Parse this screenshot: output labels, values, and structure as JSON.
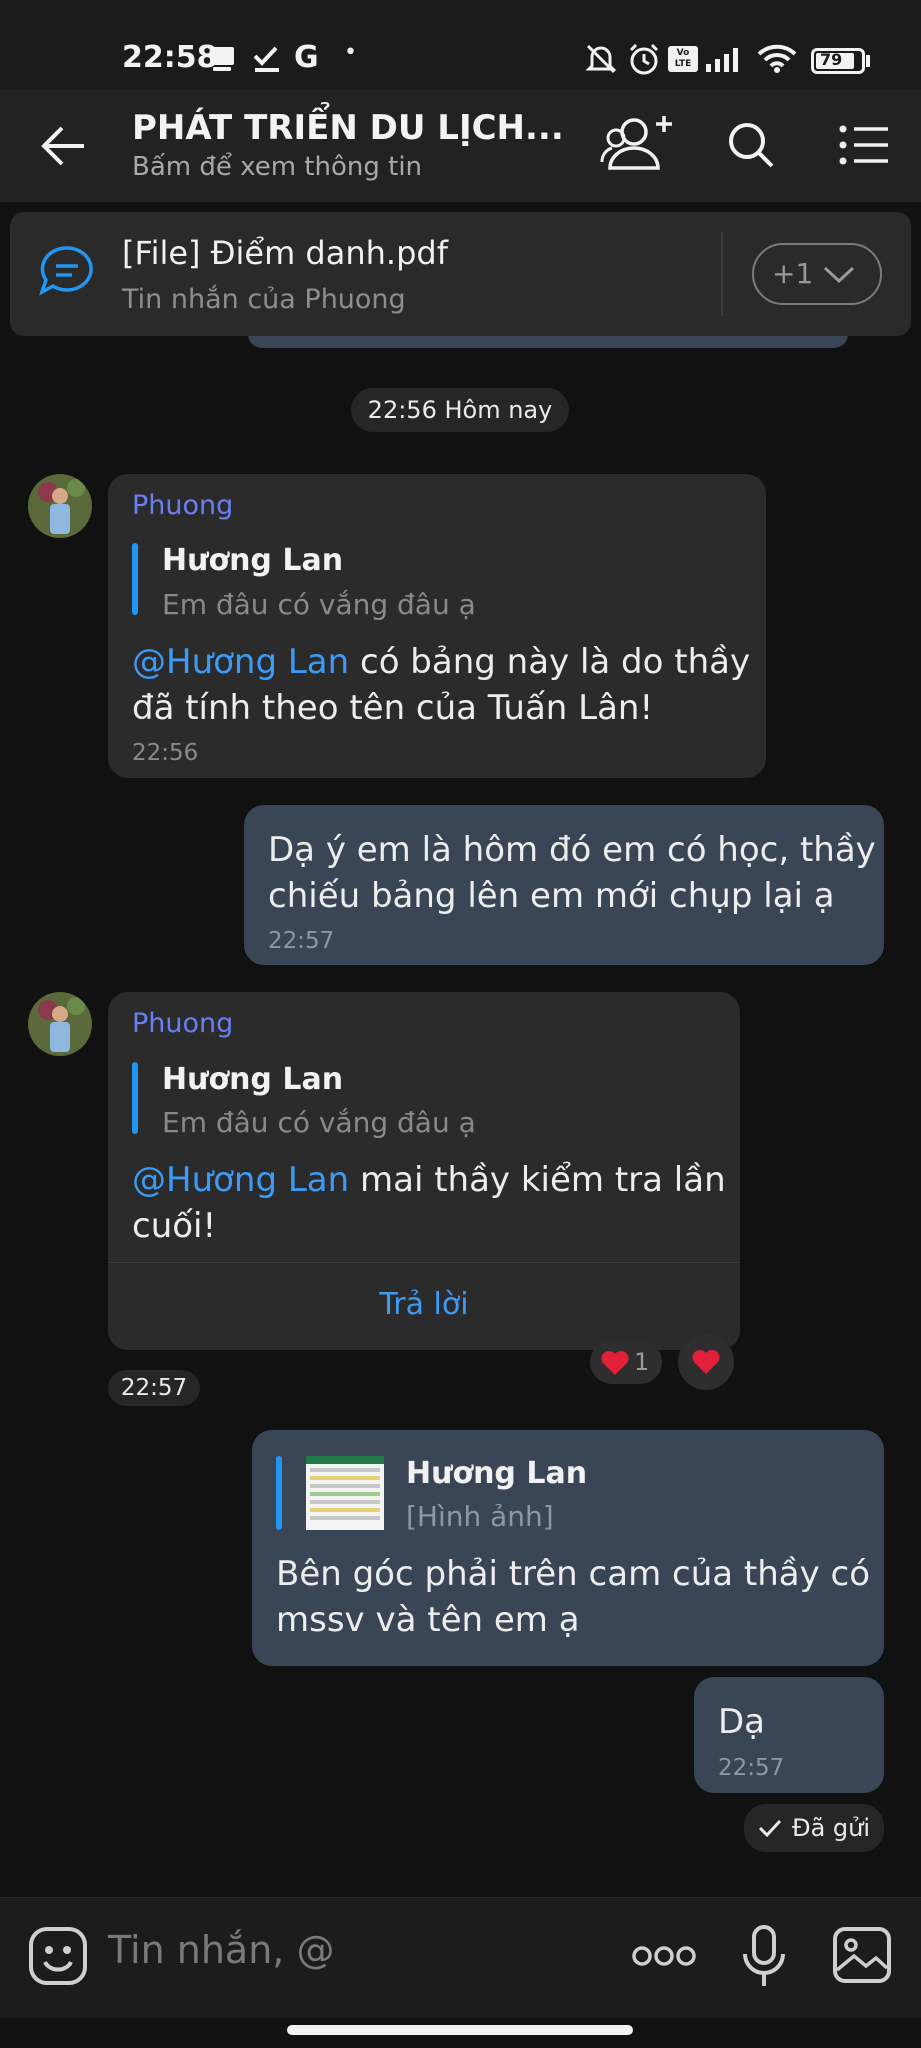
{
  "status_bar": {
    "time": "22:58",
    "g_label": "G",
    "dot": "•",
    "battery": "79",
    "volte_label": "Vo LTE"
  },
  "header": {
    "title": "PHÁT TRIỂN DU LỊCH...",
    "subtitle": "Bấm để xem thông tin"
  },
  "pinned": {
    "title": "[File] Điểm danh.pdf",
    "subtitle": "Tin nhắn của Phuong",
    "more_label": "+1"
  },
  "chat": {
    "date_chip": "22:56 Hôm nay",
    "messages": [
      {
        "sender": "Phuong",
        "quote_name": "Hương Lan",
        "quote_text": "Em đâu có vắng đâu ạ",
        "mention": "@Hương Lan",
        "line1": " có bảng này là do thầy",
        "line2": "đã tính theo tên của Tuấn Lân!",
        "time": "22:56"
      },
      {
        "line1": "Dạ ý em là hôm đó em có học, thầy",
        "line2": "chiếu bảng lên em mới chụp lại ạ",
        "time": "22:57"
      },
      {
        "sender": "Phuong",
        "quote_name": "Hương Lan",
        "quote_text": "Em đâu có vắng đâu ạ",
        "mention": "@Hương Lan",
        "line1": " mai thầy kiểm tra lần",
        "line2": "cuối!",
        "reply_label": "Trả lời",
        "time": "22:57",
        "reaction_count": "1"
      },
      {
        "quote_name": "Hương Lan",
        "quote_text": "[Hình ảnh]",
        "line1": "Bên góc phải trên cam của thầy có",
        "line2": "mssv và tên em ạ"
      },
      {
        "line1": "Dạ",
        "time": "22:57"
      }
    ],
    "sent_status": "Đã gửi"
  },
  "composer": {
    "placeholder": "Tin nhắn, @"
  },
  "colors": {
    "background": "#111111",
    "incoming_bubble": "#2b2b2b",
    "outgoing_bubble": "#3a4656",
    "accent": "#2196f3",
    "mention": "#3d9bf5",
    "sender_name": "#6a7ff2"
  }
}
